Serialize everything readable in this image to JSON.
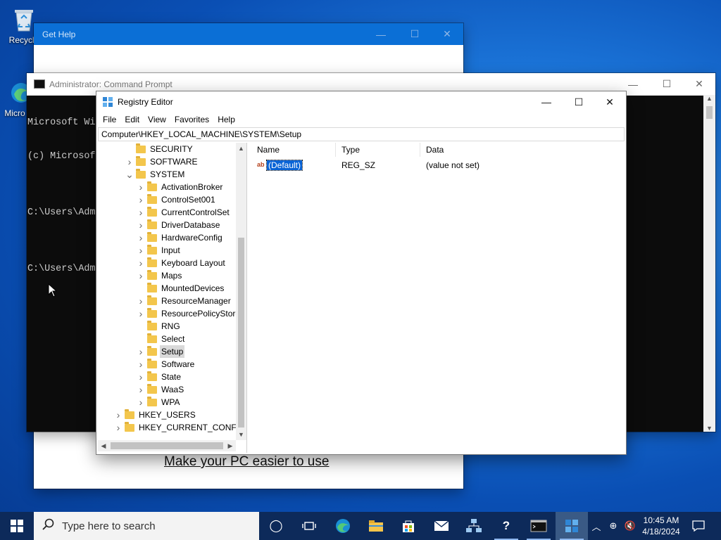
{
  "desktop": {
    "icons": [
      {
        "label": "Recycle",
        "icon": "recycle-bin-icon"
      },
      {
        "label": "Micro Ed",
        "icon": "edge-shortcut-icon"
      }
    ]
  },
  "gethelp": {
    "title": "Get Help",
    "link": "Make your PC easier to use"
  },
  "cmd": {
    "title": "Administrator: Command Prompt",
    "lines": [
      "Microsoft Wi",
      "(c) Microsof",
      "",
      "C:\\Users\\Adm",
      "",
      "C:\\Users\\Adm"
    ]
  },
  "regedit": {
    "title": "Registry Editor",
    "menu": [
      "File",
      "Edit",
      "View",
      "Favorites",
      "Help"
    ],
    "address": "Computer\\HKEY_LOCAL_MACHINE\\SYSTEM\\Setup",
    "tree": [
      {
        "label": "SECURITY",
        "level": 1,
        "expander": "none"
      },
      {
        "label": "SOFTWARE",
        "level": 1,
        "expander": "collapsed"
      },
      {
        "label": "SYSTEM",
        "level": 1,
        "expander": "expanded"
      },
      {
        "label": "ActivationBroker",
        "level": 2,
        "expander": "collapsed"
      },
      {
        "label": "ControlSet001",
        "level": 2,
        "expander": "collapsed"
      },
      {
        "label": "CurrentControlSet",
        "level": 2,
        "expander": "collapsed"
      },
      {
        "label": "DriverDatabase",
        "level": 2,
        "expander": "collapsed"
      },
      {
        "label": "HardwareConfig",
        "level": 2,
        "expander": "collapsed"
      },
      {
        "label": "Input",
        "level": 2,
        "expander": "collapsed"
      },
      {
        "label": "Keyboard Layout",
        "level": 2,
        "expander": "collapsed"
      },
      {
        "label": "Maps",
        "level": 2,
        "expander": "collapsed"
      },
      {
        "label": "MountedDevices",
        "level": 2,
        "expander": "none"
      },
      {
        "label": "ResourceManager",
        "level": 2,
        "expander": "collapsed"
      },
      {
        "label": "ResourcePolicyStore",
        "level": 2,
        "expander": "collapsed"
      },
      {
        "label": "RNG",
        "level": 2,
        "expander": "none"
      },
      {
        "label": "Select",
        "level": 2,
        "expander": "none"
      },
      {
        "label": "Setup",
        "level": 2,
        "expander": "collapsed",
        "selected": true
      },
      {
        "label": "Software",
        "level": 2,
        "expander": "collapsed"
      },
      {
        "label": "State",
        "level": 2,
        "expander": "collapsed"
      },
      {
        "label": "WaaS",
        "level": 2,
        "expander": "collapsed"
      },
      {
        "label": "WPA",
        "level": 2,
        "expander": "collapsed"
      },
      {
        "label": "HKEY_USERS",
        "level": 0,
        "expander": "collapsed"
      },
      {
        "label": "HKEY_CURRENT_CONFIG",
        "level": 0,
        "expander": "collapsed"
      }
    ],
    "columns": {
      "name": "Name",
      "type": "Type",
      "data": "Data"
    },
    "values": [
      {
        "name": "(Default)",
        "type": "REG_SZ",
        "data": "(value not set)",
        "icon": "string-value-icon"
      }
    ]
  },
  "taskbar": {
    "search_placeholder": "Type here to search",
    "apps": [
      "task-view-icon",
      "edge-icon",
      "file-explorer-icon",
      "store-icon",
      "mail-icon",
      "network-app-icon",
      "get-help-icon",
      "command-prompt-icon",
      "registry-editor-icon"
    ],
    "time": "10:45 AM",
    "date": "4/18/2024"
  }
}
